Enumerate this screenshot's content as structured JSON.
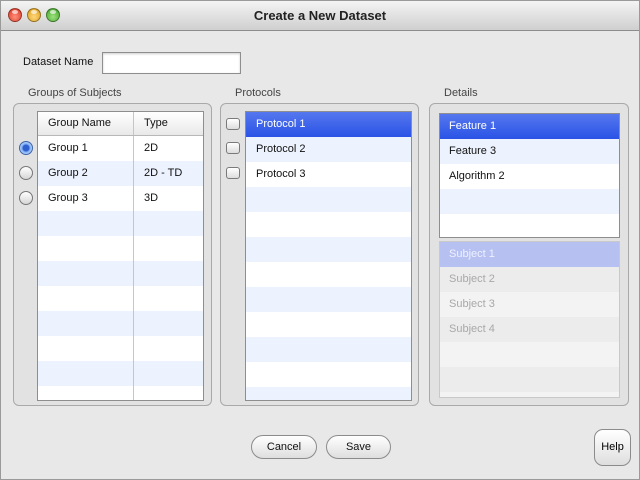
{
  "window": {
    "title": "Create a New Dataset"
  },
  "dataset": {
    "label": "Dataset Name",
    "value": ""
  },
  "groups": {
    "title": "Groups of Subjects",
    "columns": [
      "Group Name",
      "Type"
    ],
    "rows": [
      {
        "name": "Group 1",
        "type": "2D",
        "selected": true
      },
      {
        "name": "Group 2",
        "type": "2D - TD",
        "selected": false
      },
      {
        "name": "Group 3",
        "type": "3D",
        "selected": false
      }
    ]
  },
  "protocols": {
    "title": "Protocols",
    "items": [
      {
        "label": "Protocol 1",
        "selected": true,
        "checked": false
      },
      {
        "label": "Protocol 2",
        "selected": false,
        "checked": false
      },
      {
        "label": "Protocol 3",
        "selected": false,
        "checked": false
      }
    ]
  },
  "details": {
    "title": "Details",
    "features": [
      {
        "label": "Feature 1",
        "selected": true
      },
      {
        "label": "Feature 3",
        "selected": false
      },
      {
        "label": "Algorithm 2",
        "selected": false
      }
    ],
    "subjects": [
      {
        "label": "Subject 1",
        "selected": true
      },
      {
        "label": "Subject 2",
        "selected": false
      },
      {
        "label": "Subject 3",
        "selected": false
      },
      {
        "label": "Subject 4",
        "selected": false
      }
    ]
  },
  "buttons": {
    "cancel": "Cancel",
    "save": "Save",
    "help": "Help"
  },
  "colors": {
    "selection": "#2a53e6",
    "alt_row": "#edf3fe"
  }
}
